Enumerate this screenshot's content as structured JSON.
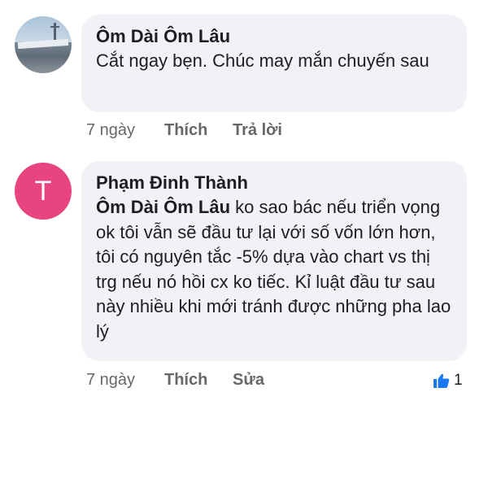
{
  "comments": [
    {
      "author": "Ôm Dài Ôm Lâu",
      "text": "Cắt ngay bẹn. Chúc may mắn chuyến sau",
      "time": "7 ngày",
      "actions": [
        "Thích",
        "Trả lời"
      ]
    },
    {
      "author": "Phạm Đinh Thành",
      "avatar_letter": "T",
      "avatar_color": "#e8447f",
      "mention": "Ôm Dài Ôm Lâu",
      "text": " ko sao bác nếu triển vọng ok tôi vẫn sẽ đầu tư lại với số vốn lớn hơn, tôi có nguyên tắc -5% dựa vào chart vs thị trg nếu nó hồi cx ko tiếc. Kỉ luật đầu tư sau này nhiều khi mới tránh được những pha lao lý",
      "time": "7 ngày",
      "actions": [
        "Thích",
        "Sửa"
      ],
      "reaction_icon": "thumbs-up-icon",
      "reaction_count": "1",
      "reaction_color": "#1877f2"
    }
  ]
}
